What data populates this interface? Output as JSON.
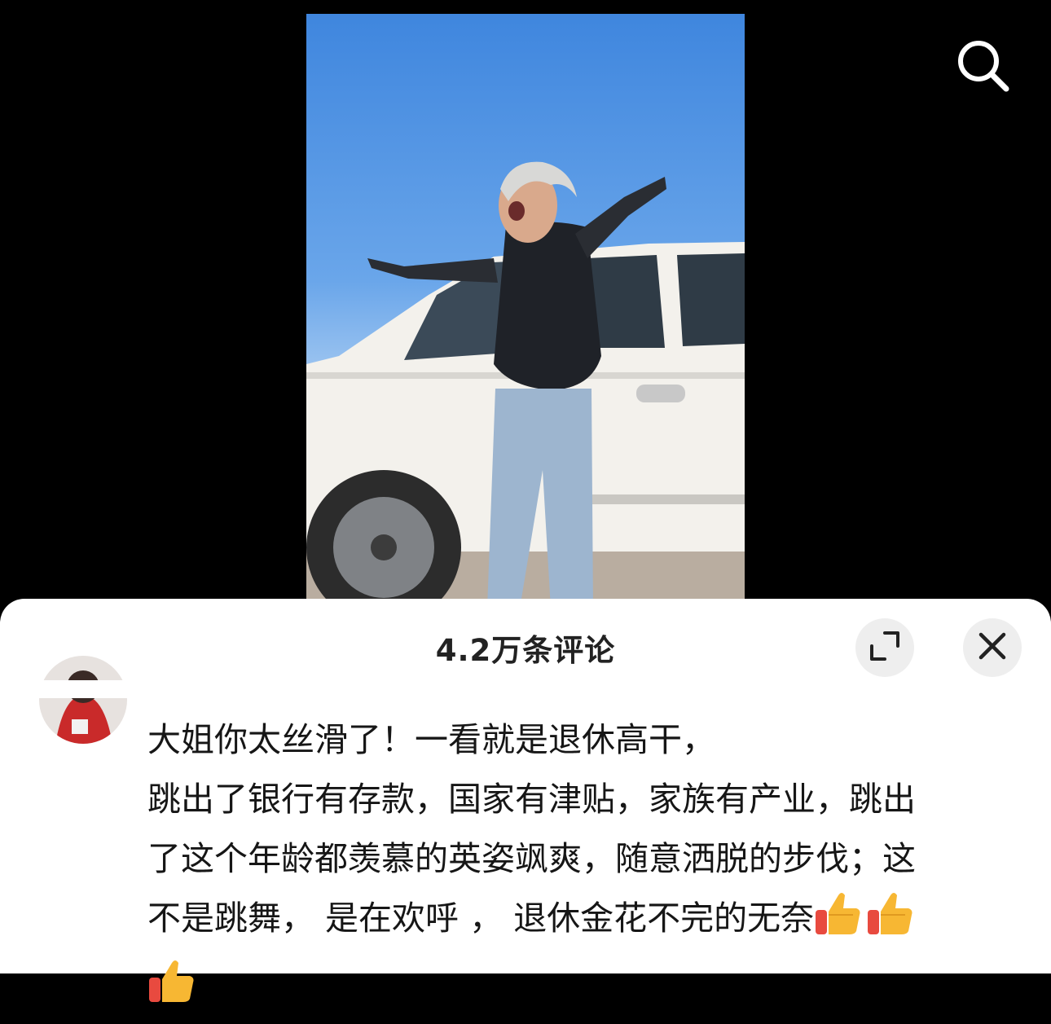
{
  "video": {
    "description_icon": "video-frame"
  },
  "toolbar": {
    "search_icon": "search-icon"
  },
  "comments_sheet": {
    "title": "4.2万条评论",
    "expand_icon": "expand-icon",
    "close_icon": "close-icon"
  },
  "comment": {
    "line1": "大姐你太丝滑了！一看就是退休高干，",
    "line2": " 跳出了银行有存款，国家有津贴，家族有产业，跳出",
    "line3": "了这个年龄都羡慕的英姿飒爽，随意洒脱的步伐；这",
    "line4": "不是跳舞，  是在欢呼 ，  退休金花不完的无奈",
    "emoji": "thumbs-up-icon"
  },
  "colors": {
    "sheet_bg": "#ffffff",
    "button_bg": "#eeeeee",
    "text": "#161616"
  }
}
